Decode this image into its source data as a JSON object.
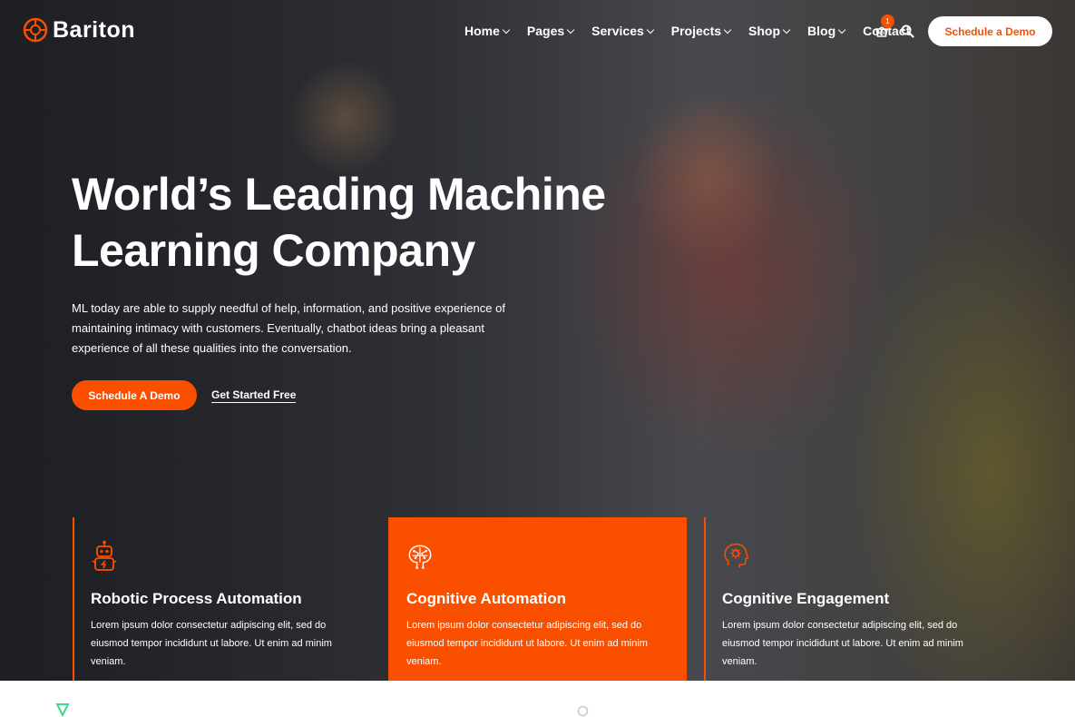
{
  "brand": {
    "name": "Bariton",
    "accent": "#fb4f00"
  },
  "nav": {
    "items": [
      {
        "label": "Home",
        "dropdown": true
      },
      {
        "label": "Pages",
        "dropdown": true
      },
      {
        "label": "Services",
        "dropdown": true
      },
      {
        "label": "Projects",
        "dropdown": true
      },
      {
        "label": "Shop",
        "dropdown": true
      },
      {
        "label": "Blog",
        "dropdown": true
      },
      {
        "label": "Contact",
        "dropdown": false
      }
    ],
    "cart_count": "1",
    "cta_label": "Schedule a Demo",
    "icons": [
      "cart-icon",
      "search-icon"
    ]
  },
  "hero": {
    "title_line1": "World’s Leading Machine",
    "title_line2": "Learning Company",
    "description": "ML today are able to supply needful of help, information, and positive experience of maintaining intimacy with customers. Eventually, chatbot ideas bring a pleasant experience of all these qualities into the conversation.",
    "primary_label": "Schedule A Demo",
    "secondary_label": "Get Started Free"
  },
  "features": [
    {
      "icon": "robot-icon",
      "title": "Robotic Process Automation",
      "text": "Lorem ipsum dolor consectetur adipiscing elit, sed do eiusmod tempor incididunt ut labore. Ut enim ad minim veniam."
    },
    {
      "icon": "brain-circuit-icon",
      "title": "Cognitive Automation",
      "text": "Lorem ipsum dolor consectetur adipiscing elit, sed do eiusmod tempor incididunt ut labore. Ut enim ad minim veniam."
    },
    {
      "icon": "head-gear-icon",
      "title": "Cognitive Engagement",
      "text": "Lorem ipsum dolor consectetur adipiscing elit, sed do eiusmod tempor incididunt ut labore. Ut enim ad minim veniam."
    }
  ]
}
